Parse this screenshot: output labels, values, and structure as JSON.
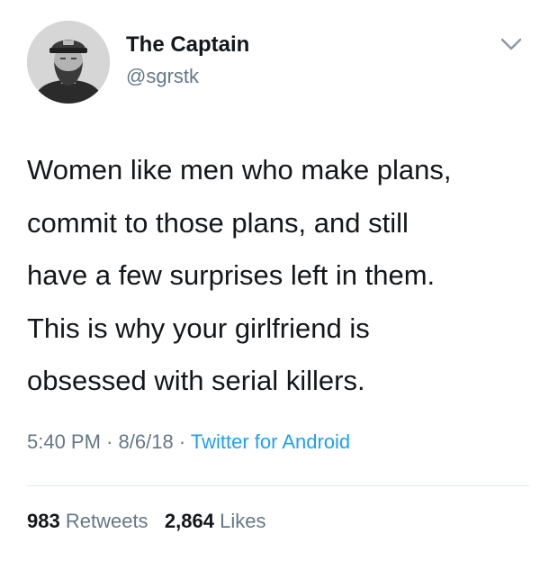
{
  "author": {
    "display_name": "The Captain",
    "handle": "@sgrstk",
    "avatar_icon": "profile-photo-captain-hat"
  },
  "menu": {
    "icon": "chevron-down-icon"
  },
  "tweet": {
    "text": "Women like men who make plans,\ncommit to those plans, and still\nhave a few surprises left in them.\nThis is why your girlfriend is\nobsessed with serial killers.",
    "time": "5:40 PM",
    "separator": "·",
    "date": "8/6/18",
    "source": "Twitter for Android"
  },
  "stats": {
    "retweets_count": "983",
    "retweets_label": "Retweets",
    "likes_count": "2,864",
    "likes_label": "Likes"
  },
  "colors": {
    "text_primary": "#14171a",
    "text_secondary": "#657786",
    "link": "#1da1f2",
    "divider": "#e1e8ed"
  }
}
